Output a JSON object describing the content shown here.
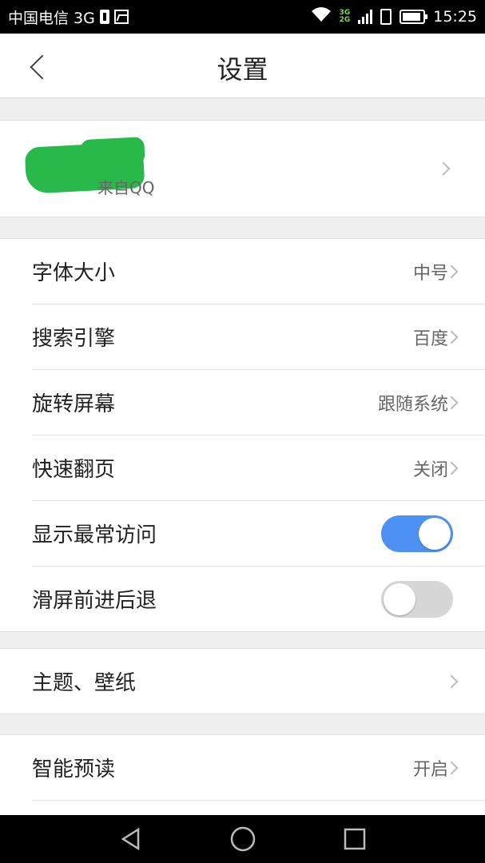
{
  "status_bar": {
    "carrier": "中国电信 3G",
    "network_top": "3G",
    "network_bottom": "2G",
    "time": "15:25"
  },
  "header": {
    "title": "设置"
  },
  "account": {
    "source": "来自QQ"
  },
  "settings_group1": [
    {
      "label": "字体大小",
      "value": "中号"
    },
    {
      "label": "搜索引擎",
      "value": "百度"
    },
    {
      "label": "旋转屏幕",
      "value": "跟随系统"
    },
    {
      "label": "快速翻页",
      "value": "关闭"
    },
    {
      "label": "显示最常访问",
      "toggle": "on"
    },
    {
      "label": "滑屏前进后退",
      "toggle": "off"
    }
  ],
  "settings_group2": [
    {
      "label": "主题、壁纸"
    }
  ],
  "settings_group3": [
    {
      "label": "智能预读",
      "value": "开启"
    }
  ],
  "colors": {
    "toggle_on": "#4e91f4",
    "toggle_off": "#d6d6d6",
    "scribble": "#29b94a"
  }
}
